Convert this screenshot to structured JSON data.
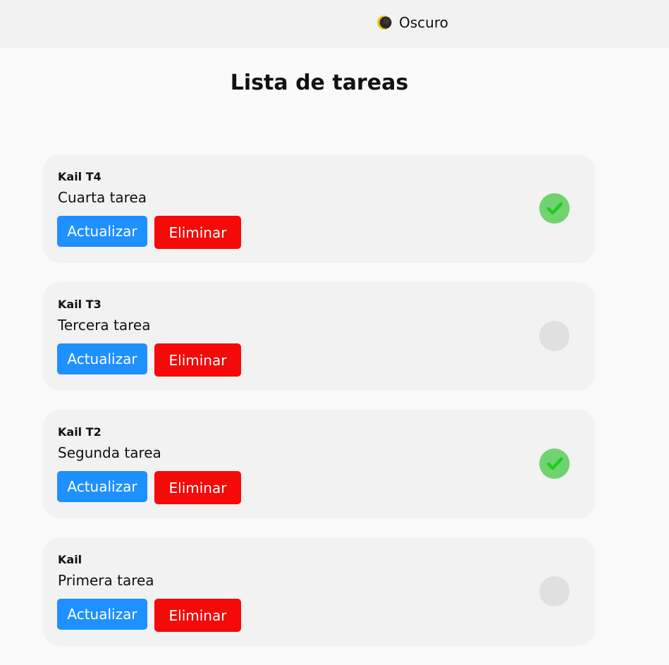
{
  "header": {
    "theme_icon": "moon-icon",
    "theme_label": "Oscuro"
  },
  "page": {
    "title": "Lista de tareas"
  },
  "tasks": [
    {
      "author": "Kail T4",
      "description": "Cuarta tarea",
      "completed": true,
      "update_label": "Actualizar",
      "delete_label": "Eliminar"
    },
    {
      "author": "Kail T3",
      "description": "Tercera tarea",
      "completed": false,
      "update_label": "Actualizar",
      "delete_label": "Eliminar"
    },
    {
      "author": "Kail T2",
      "description": "Segunda tarea",
      "completed": true,
      "update_label": "Actualizar",
      "delete_label": "Eliminar"
    },
    {
      "author": "Kail",
      "description": "Primera tarea",
      "completed": false,
      "update_label": "Actualizar",
      "delete_label": "Eliminar"
    }
  ],
  "colors": {
    "update_button": "#1e90ff",
    "delete_button": "#f50a0a",
    "done_status": "#6fd36f",
    "checkmark": "#22c922",
    "pending_status": "#e0e0e0"
  }
}
